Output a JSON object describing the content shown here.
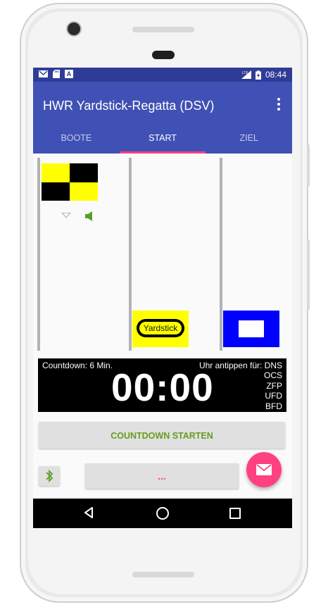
{
  "status_bar": {
    "time": "08:44",
    "icons": [
      "gmail-icon",
      "sdcard-icon",
      "app-icon",
      "lte-signal-icon",
      "battery-icon"
    ]
  },
  "app_bar": {
    "title": "HWR Yardstick-Regatta (DSV)",
    "menu_icon": "overflow-menu-icon"
  },
  "tabs": [
    {
      "label": "BOOTE",
      "active": false
    },
    {
      "label": "START",
      "active": true
    },
    {
      "label": "ZIEL",
      "active": false
    }
  ],
  "flags": {
    "left": "checkered-flag",
    "middle_label": "Yardstick",
    "right": "blue-peter-flag"
  },
  "timer": {
    "countdown_label": "Countdown: 6 Min.",
    "tap_label": "Uhr antippen für: DNS",
    "time": "00:00",
    "codes": [
      "OCS",
      "ZFP",
      "UFD",
      "BFD"
    ]
  },
  "buttons": {
    "countdown_start": "COUNTDOWN STARTEN",
    "dots": "...",
    "bluetooth_icon": "bluetooth-icon",
    "fab_icon": "mail-icon"
  },
  "colors": {
    "primary": "#3f51b5",
    "status_bar": "#2f3c97",
    "accent": "#ff4081",
    "button_text": "#6a9a1f"
  }
}
